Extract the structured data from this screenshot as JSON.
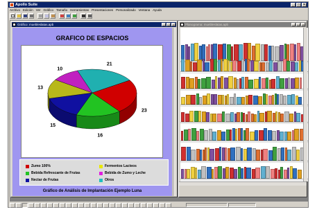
{
  "app": {
    "title": "Apollo Suite"
  },
  "menu": [
    "Archivo",
    "Edición",
    "Ver",
    "Gráfico",
    "Tamaño",
    "Herramientas",
    "Presentaciones",
    "Personalizado",
    "Ventana",
    "Ayuda"
  ],
  "windows": {
    "chart": {
      "title": "Gráfico: muebleslatas.apb"
    },
    "planogram": {
      "title": "Planograma: muebleslatas.apb"
    }
  },
  "chart_data": {
    "type": "pie",
    "title": "GRAFICO DE ESPACIOS",
    "caption": "Gráfico de Análisis de Implantación Ejemplo Luna",
    "series": [
      {
        "name": "Zumo 100%",
        "value": 23,
        "color": "#d00000"
      },
      {
        "name": "Bebida Refrescante de Frutas",
        "value": 16,
        "color": "#22c322"
      },
      {
        "name": "Nectar de Frutas",
        "value": 15,
        "color": "#1010a0"
      },
      {
        "name": "Fermentos Lacteos",
        "value": 13,
        "color": "#b8b81a"
      },
      {
        "name": "Bebida de Zumo y Leche",
        "value": 10,
        "color": "#c020c0"
      },
      {
        "name": "Otros",
        "value": 21,
        "color": "#20b0b0"
      }
    ]
  }
}
